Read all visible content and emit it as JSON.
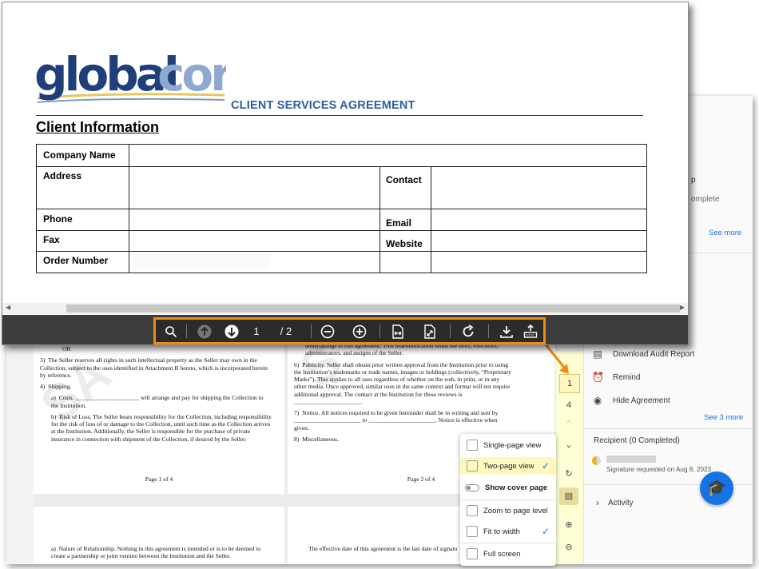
{
  "background": {
    "side_panel": {
      "partial_1": "p",
      "partial_2": "omplete",
      "see_more": "See more",
      "actions": [
        {
          "label": "Download Audit Report",
          "icon": "report-icon"
        },
        {
          "label": "Remind",
          "icon": "alarm-clock-icon"
        },
        {
          "label": "Hide Agreement",
          "icon": "eye-off-icon"
        }
      ],
      "see_3_more": "See 3 more",
      "recipient_header": "Recipient (0 Completed)",
      "signature_status": "Signature requested on Aug 8, 2023",
      "activity": "Activity"
    },
    "page_rail": {
      "current_page": "1",
      "total_pages": "4"
    },
    "view_menu": {
      "items": [
        {
          "label": "Single-page view",
          "checked": false
        },
        {
          "label": "Two-page view",
          "checked": true
        },
        {
          "label": "Show cover page",
          "checked": false
        },
        {
          "label": "Zoom to page level",
          "checked": false
        },
        {
          "label": "Fit to width",
          "checked": true
        },
        {
          "label": "Full screen",
          "checked": false
        }
      ]
    },
    "doc_pages": {
      "left": {
        "or": "OR",
        "item3": "3)  The Seller reserves all rights in such intellectual property as the Seller may own in the Collection, subject to the uses identified in Attachment B hereto, which is incorporated herein by reference.",
        "item4": "4)  Shipping.",
        "item4a": "a)  Costs. _____________________ will arrange and pay for shipping the Collection to the Institution.",
        "item4b": "b)  Risk of Loss. The Seller bears responsibility for the Collection, including responsibility for the risk of loss of or damage to the Collection, until such time as the Collection arrives at the Institution. Additionally, the Seller is responsible for the purchase of private insurance in connection with shipment of the Collection, if desired by the Seller.",
        "footer": "Page 1 of 4",
        "next_page_text": "a)  Nature of Relationship. Nothing in this agreement is intended or is to be deemed to create a partnership or joint venture between the Institution and the Seller."
      },
      "right": {
        "top_line": "undertakings in this agreement. This indemnification binds the heirs, executors, administrators, and assigns of the Seller.",
        "item6": "6)  Publicity. Seller shall obtain prior written approval from the Institution prior to using the Institution’s trademarks or trade names, images or holdings (collectively, “Proprietary Marks”). This applies to all uses regardless of whether on the web, in print, or in any other media. Once approved, similar uses in the same context and format will not require additional approval. The contact at the Institution for these reviews is ______________________.",
        "item7": "7)  Notice. All notices required to be given hereunder shall be in writing and sent by ______________________ to ______________________. Notice is effective when given.",
        "item8": "8)  Miscellaneous.",
        "footer": "Page 2 of 4",
        "next_page_text": "The effective date of this agreement is the last date of signatu"
      }
    }
  },
  "document": {
    "logo_text": "globalcorp",
    "title": "CLIENT SERVICES AGREEMENT",
    "section": "Client Information",
    "fields": {
      "company_name": "Company Name",
      "address": "Address",
      "contact": "Contact",
      "phone": "Phone",
      "email": "Email",
      "fax": "Fax",
      "website": "Website",
      "order_number": "Order Number"
    }
  },
  "toolbar": {
    "current_page": "1",
    "page_total": "/ 2",
    "icons": [
      "search-icon",
      "previous-page-icon",
      "next-page-icon",
      "zoom-out-icon",
      "zoom-in-icon",
      "fit-width-icon",
      "fit-page-icon",
      "rotate-icon",
      "download-icon",
      "print-icon"
    ]
  },
  "colors": {
    "highlight": "#f08a12",
    "accent": "#1473e6",
    "title_blue": "#2c5fa0",
    "rail_bg": "#ffffd6"
  }
}
